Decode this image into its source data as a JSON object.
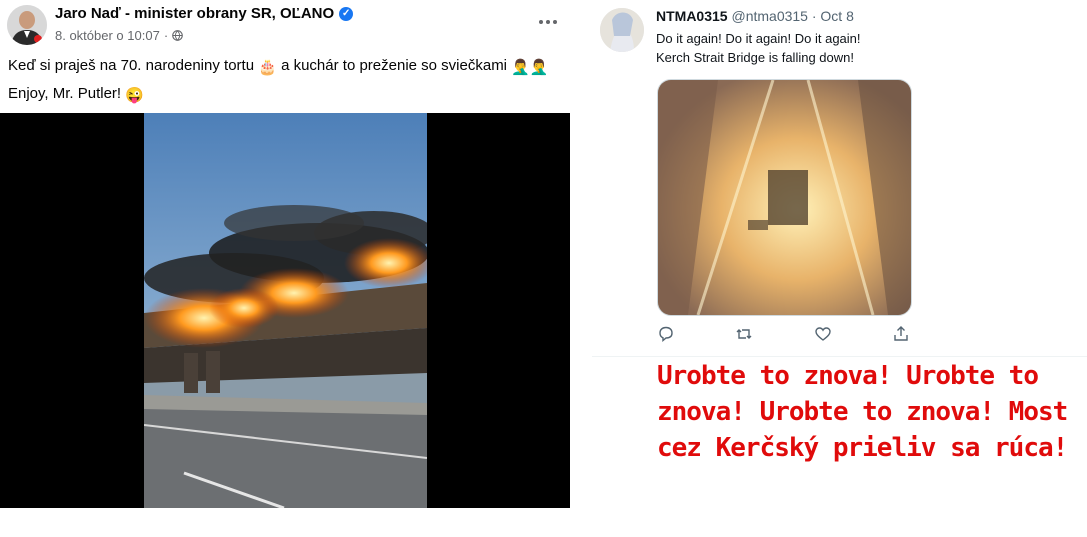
{
  "facebook_post": {
    "author": "Jaro Naď - minister obrany SR, OĽANO",
    "date": "8. október o 10:07",
    "separator": "·",
    "text_line1": "Keď si praješ na 70. narodeniny tortu",
    "cake_emoji": "🎂",
    "text_line1_cont": "a kuchár to preženie so sviečkami",
    "chef_emoji": "🤦‍♂️🤦‍♂️",
    "text_line2": "Enjoy, Mr. Putler!",
    "wink_emoji": "😜",
    "verified_icon": "check-badge-icon",
    "colors": {
      "verified": "#1877f2",
      "meta": "#65676b"
    }
  },
  "tweet": {
    "name": "NTMA0315",
    "handle": "@ntma0315",
    "separator": "·",
    "date": "Oct 8",
    "line1": "Do it again! Do it again! Do it again!",
    "line2": "Kerch Strait Bridge is falling down!",
    "actions": [
      "reply-icon",
      "retweet-icon",
      "like-icon",
      "share-icon"
    ]
  },
  "caption": {
    "text": "Urobte to znova! Urobte to znova! Urobte to znova! Most cez Kerčský prieliv sa rúca!",
    "color": "#e00b0b"
  }
}
